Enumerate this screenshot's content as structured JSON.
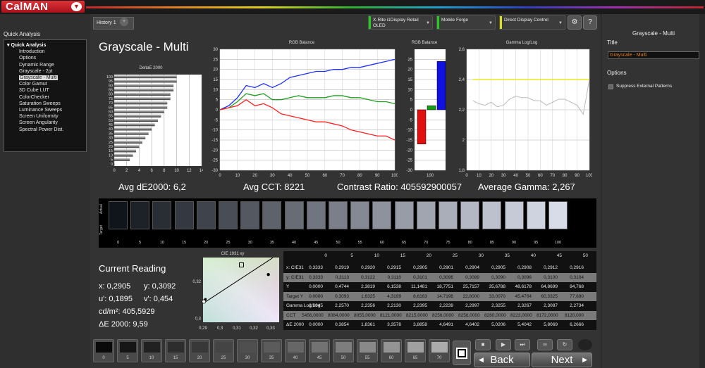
{
  "app": {
    "name": "CalMAN"
  },
  "left_panel": {
    "header": "Quick Analysis",
    "root": "Quick Analysis",
    "items": [
      "Introduction",
      "Options",
      "Dynamic Range",
      "Grayscale - 2pt",
      "Grayscale - Multi",
      "Color Gamut",
      "3D Cube LUT",
      "ColorChecker",
      "Saturation Sweeps",
      "Luminance Sweeps",
      "Screen Uniformity",
      "Screen Angularity",
      "Spectral Power Dist."
    ],
    "selected_index": 4
  },
  "tabs": [
    {
      "label": "History 1"
    }
  ],
  "devices": {
    "meter_line1": "X-Rite i1Display Retail",
    "meter_line2": "OLED",
    "source": "Mobile Forge",
    "display": "Direct Display Control"
  },
  "page": {
    "title": "Grayscale - Multi"
  },
  "stats": {
    "avg_de": "Avg dE2000: 6,2",
    "avg_cct": "Avg CCT: 8221",
    "contrast": "Contrast Ratio: 405592900057",
    "gamma": "Average Gamma: 2,267"
  },
  "chart_data": [
    {
      "type": "bar",
      "title": "DeltaE 2000",
      "orientation": "horizontal",
      "categories": [
        "0",
        "5",
        "10",
        "15",
        "20",
        "25",
        "30",
        "35",
        "40",
        "45",
        "50",
        "55",
        "60",
        "65",
        "70",
        "75",
        "80",
        "85",
        "90",
        "95",
        "100"
      ],
      "values": [
        0,
        2.5,
        3,
        3.5,
        4,
        4.5,
        5,
        5.5,
        6,
        6.5,
        7,
        7.5,
        8,
        8.5,
        8.5,
        9,
        9,
        9.5,
        9.5,
        10,
        10
      ],
      "xlim": [
        0,
        14
      ],
      "xticks": [
        "0",
        "2",
        "4",
        "6",
        "8",
        "10",
        "12",
        "14"
      ],
      "yticks": [
        "100",
        "95",
        "90",
        "85",
        "80",
        "75",
        "70",
        "65",
        "60",
        "55",
        "50",
        "45",
        "40",
        "35",
        "30",
        "25",
        "20",
        "15",
        "10",
        "5",
        "0"
      ]
    },
    {
      "type": "line",
      "title": "RGB Balance",
      "x": [
        0,
        5,
        10,
        15,
        20,
        25,
        30,
        35,
        40,
        45,
        50,
        55,
        60,
        65,
        70,
        75,
        80,
        85,
        90,
        95,
        100
      ],
      "series": [
        {
          "color": "#2030ff",
          "values": [
            0,
            2,
            6,
            12,
            11,
            13,
            11,
            13,
            16,
            17,
            18,
            19,
            19,
            20,
            20,
            21,
            21,
            22,
            23,
            24,
            25
          ]
        },
        {
          "color": "#20a020",
          "values": [
            0,
            1,
            4,
            8,
            7,
            8,
            5,
            5,
            6,
            7,
            6,
            6,
            6,
            7,
            7,
            6,
            6,
            5,
            4,
            4,
            3
          ]
        },
        {
          "color": "#ff2020",
          "values": [
            0,
            1,
            2,
            5,
            2,
            3,
            1,
            -2,
            -3,
            -4,
            -5,
            -6,
            -6,
            -7,
            -8,
            -10,
            -11,
            -12,
            -13,
            -13,
            -15
          ]
        }
      ],
      "ylim": [
        -30,
        30
      ],
      "yticks": [
        "30",
        "25",
        "20",
        "15",
        "10",
        "5",
        "0",
        "-5",
        "-10",
        "-15",
        "-20",
        "-25",
        "-30"
      ],
      "xticks": [
        "0",
        "10",
        "20",
        "30",
        "40",
        "50",
        "60",
        "70",
        "80",
        "90",
        "100"
      ]
    },
    {
      "type": "bar",
      "title": "RGB Balance",
      "categories": [
        "R",
        "G",
        "B"
      ],
      "values": [
        -17,
        2,
        24
      ],
      "colors": [
        "#e01010",
        "#10a010",
        "#1010e0"
      ],
      "ylim": [
        -30,
        30
      ],
      "yticks": [
        "25",
        "20",
        "15",
        "10",
        "5",
        "0",
        "-5",
        "-10",
        "-15",
        "-20",
        "-25",
        "-30"
      ],
      "xlabel": "100"
    },
    {
      "type": "line",
      "title": "Gamma Log/Log",
      "x": [
        5,
        10,
        15,
        20,
        25,
        30,
        35,
        40,
        45,
        50,
        55,
        60,
        65,
        70,
        75,
        80,
        85,
        90,
        95,
        100
      ],
      "series": [
        {
          "color": "#bbbbbb",
          "values": [
            2.26,
            2.24,
            2.23,
            2.25,
            2.22,
            2.23,
            2.27,
            2.29,
            2.28,
            2.28,
            2.26,
            2.26,
            2.23,
            2.25,
            2.27,
            2.27,
            2.25,
            2.23,
            2.17,
            2.4
          ]
        },
        {
          "color": "#e8e820",
          "values": [
            2.4,
            2.4,
            2.4,
            2.4,
            2.4,
            2.4,
            2.4,
            2.4,
            2.4,
            2.4,
            2.4,
            2.4,
            2.4,
            2.4,
            2.4,
            2.4,
            2.4,
            2.4,
            2.4,
            2.4
          ]
        }
      ],
      "ylim": [
        1.8,
        2.6
      ],
      "yticks": [
        "2,6",
        "2,4",
        "2,2",
        "2",
        "1,8"
      ],
      "xticks": [
        "0",
        "10",
        "20",
        "30",
        "40",
        "50",
        "60",
        "70",
        "80",
        "90",
        "100"
      ]
    },
    {
      "type": "scatter",
      "title": "CIE 1931 xy",
      "xticks": [
        "0,29",
        "0,3",
        "0,31",
        "0,32",
        "0,33"
      ],
      "yticks": [
        "0,32",
        "0,3"
      ],
      "points": [
        {
          "x": 0.2905,
          "y": 0.3092
        }
      ]
    }
  ],
  "swatches": {
    "actual_label": "Actual",
    "target_label": "Target",
    "levels": [
      "0",
      "5",
      "10",
      "15",
      "20",
      "25",
      "30",
      "35",
      "40",
      "45",
      "50",
      "55",
      "60",
      "65",
      "70",
      "75",
      "80",
      "85",
      "90",
      "95",
      "100"
    ]
  },
  "reading": {
    "title": "Current Reading",
    "x": "x: 0,2905",
    "y": "y: 0,3092",
    "u": "u': 0,1895",
    "v": "v': 0,454",
    "cd": "cd/m²: 405,5929",
    "de": "ΔE 2000: 9,59"
  },
  "table": {
    "columns": [
      "0",
      "5",
      "10",
      "15",
      "20",
      "25",
      "30",
      "35",
      "40",
      "45",
      "50"
    ],
    "rows": [
      {
        "label": "x: CIE31",
        "values": [
          "0,3333",
          "0,2919",
          "0,2920",
          "0,2915",
          "0,2905",
          "0,2901",
          "0,2904",
          "0,2905",
          "0,2908",
          "0,2912",
          "0,2916"
        ]
      },
      {
        "label": "y: CIE31",
        "values": [
          "0,3333",
          "0,3113",
          "0,3122",
          "0,3110",
          "0,3101",
          "0,3096",
          "0,3089",
          "0,3090",
          "0,3096",
          "0,3100",
          "0,3104"
        ]
      },
      {
        "label": "Y",
        "values": [
          "0,0000",
          "0,4744",
          "2,3819",
          "6,1538",
          "11,1481",
          "18,7751",
          "25,7157",
          "35,6788",
          "48,6178",
          "64,8699",
          "84,768"
        ]
      },
      {
        "label": "Target Y",
        "values": [
          "0,0000",
          "0,3093",
          "1,6325",
          "4,3199",
          "8,6163",
          "14,7198",
          "22,8000",
          "33,0070",
          "45,4764",
          "60,3325",
          "77,690"
        ]
      },
      {
        "label": "Gamma Log/Log",
        "values": [
          "2,3945",
          "2,2570",
          "2,2356",
          "2,2130",
          "2,2395",
          "2,2239",
          "2,2997",
          "2,3255",
          "2,3267",
          "2,3087",
          "2,2734"
        ]
      },
      {
        "label": "CCT",
        "values": [
          "5456,0000",
          "8084,0000",
          "8055,0000",
          "8121,0000",
          "8215,0000",
          "8256,0000",
          "8256,0000",
          "8260,0000",
          "8223,0000",
          "8172,0000",
          "8120,000"
        ]
      },
      {
        "label": "ΔE 2000",
        "values": [
          "0,0000",
          "0,3854",
          "1,8361",
          "3,3578",
          "3,8858",
          "4,6491",
          "4,6402",
          "5,0206",
          "5,4042",
          "5,8069",
          "6,2666"
        ]
      }
    ]
  },
  "bottom_swatches": [
    "0",
    "5",
    "10",
    "15",
    "20",
    "25",
    "30",
    "35",
    "40",
    "45",
    "50",
    "55",
    "60",
    "65",
    "70"
  ],
  "controls": {
    "back": "Back",
    "next": "Next"
  },
  "right_panel": {
    "title": "Grayscale - Multi",
    "title_label": "Title",
    "title_value": "Grayscale - Multi",
    "options_label": "Options",
    "suppress_label": "Suppress External Patterns"
  }
}
